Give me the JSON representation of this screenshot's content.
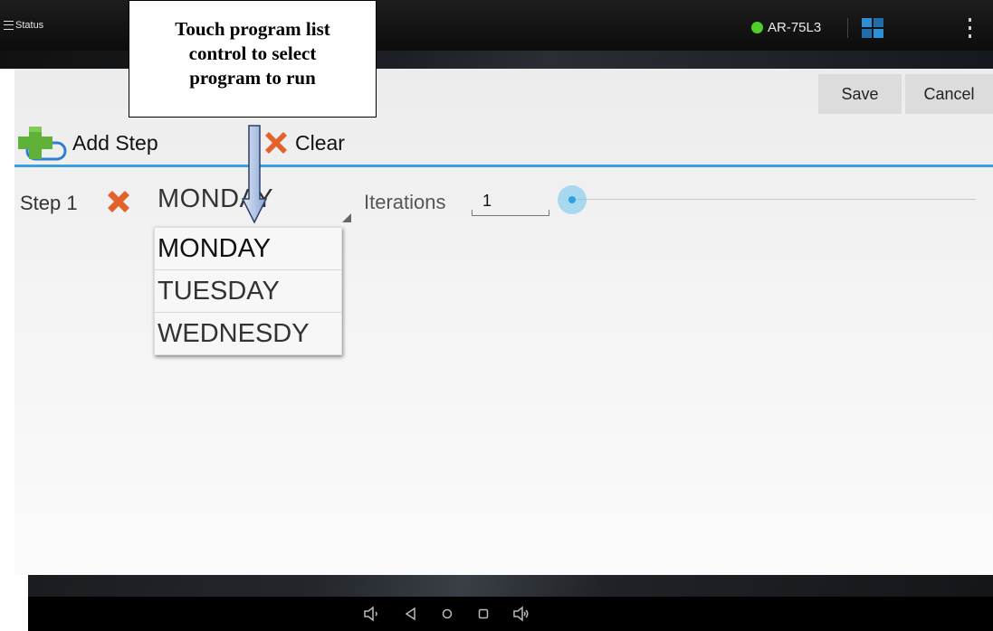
{
  "topbar": {
    "status_label": "Status",
    "device_name": "AR-75L3",
    "device_status_color": "#4fcf2a",
    "icons": [
      "hamburger-icon",
      "tiles-icon",
      "overflow-menu-icon"
    ]
  },
  "actions": {
    "save_label": "Save",
    "cancel_label": "Cancel"
  },
  "toolbar": {
    "add_step_label": "Add Step",
    "clear_label": "Clear"
  },
  "step": {
    "label": "Step 1",
    "selected_program": "MONDAY",
    "iterations_label": "Iterations",
    "iterations_value": "1"
  },
  "dropdown": {
    "options": [
      "MONDAY",
      "TUESDAY",
      "WEDNESDY"
    ]
  },
  "callout": {
    "lines": [
      "Touch program list",
      "control to select",
      "program to run"
    ]
  },
  "colors": {
    "accent": "#3a9ee0",
    "delete": "#e2622b",
    "add": "#5fb13a"
  }
}
